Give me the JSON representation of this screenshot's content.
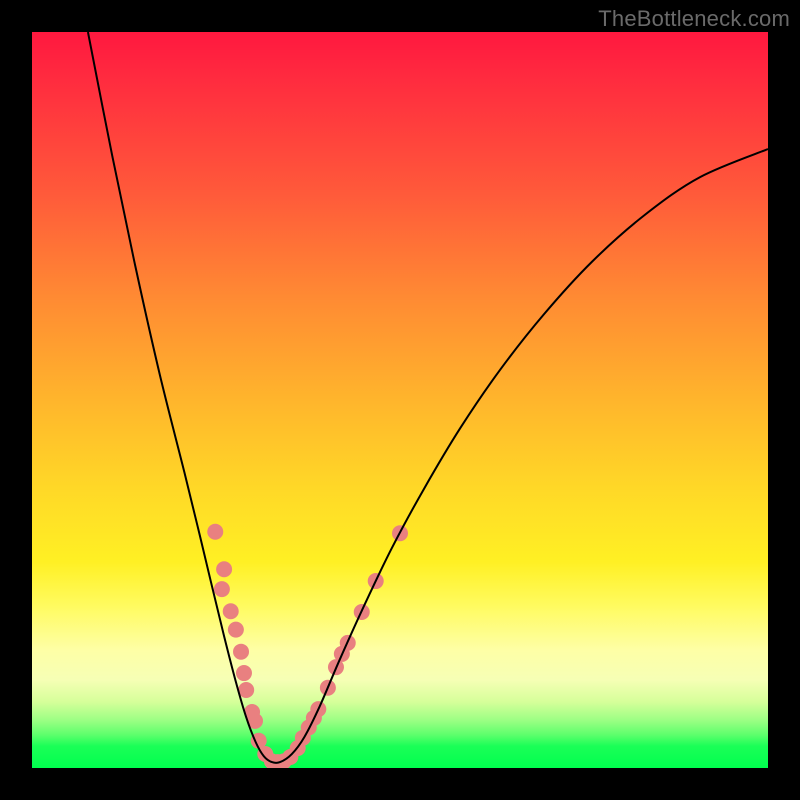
{
  "watermark": "TheBottleneck.com",
  "chart_data": {
    "type": "line",
    "title": "",
    "xlabel": "",
    "ylabel": "",
    "xlim": [
      0,
      100
    ],
    "ylim": [
      0,
      100
    ],
    "grid": false,
    "legend": false,
    "curve_points": [
      {
        "x": 7.6,
        "y": 100.0
      },
      {
        "x": 10.9,
        "y": 83.2
      },
      {
        "x": 14.1,
        "y": 67.9
      },
      {
        "x": 17.4,
        "y": 53.3
      },
      {
        "x": 20.7,
        "y": 40.2
      },
      {
        "x": 22.8,
        "y": 31.6
      },
      {
        "x": 24.5,
        "y": 24.5
      },
      {
        "x": 26.1,
        "y": 17.9
      },
      {
        "x": 27.7,
        "y": 11.7
      },
      {
        "x": 29.1,
        "y": 6.9
      },
      {
        "x": 30.4,
        "y": 3.5
      },
      {
        "x": 31.5,
        "y": 1.6
      },
      {
        "x": 32.6,
        "y": 0.8
      },
      {
        "x": 33.7,
        "y": 0.8
      },
      {
        "x": 35.3,
        "y": 1.9
      },
      {
        "x": 37.0,
        "y": 4.2
      },
      {
        "x": 39.1,
        "y": 8.4
      },
      {
        "x": 41.8,
        "y": 14.7
      },
      {
        "x": 45.1,
        "y": 22.0
      },
      {
        "x": 48.9,
        "y": 29.9
      },
      {
        "x": 53.3,
        "y": 38.0
      },
      {
        "x": 58.2,
        "y": 46.2
      },
      {
        "x": 63.6,
        "y": 54.1
      },
      {
        "x": 69.6,
        "y": 61.7
      },
      {
        "x": 76.1,
        "y": 68.8
      },
      {
        "x": 83.2,
        "y": 75.1
      },
      {
        "x": 90.8,
        "y": 80.3
      },
      {
        "x": 100.0,
        "y": 84.1
      }
    ],
    "markers": [
      {
        "x": 24.9,
        "y": 32.1
      },
      {
        "x": 26.1,
        "y": 27.0
      },
      {
        "x": 25.8,
        "y": 24.3
      },
      {
        "x": 27.0,
        "y": 21.3
      },
      {
        "x": 27.7,
        "y": 18.8
      },
      {
        "x": 28.4,
        "y": 15.8
      },
      {
        "x": 28.8,
        "y": 12.9
      },
      {
        "x": 29.1,
        "y": 10.6
      },
      {
        "x": 29.9,
        "y": 7.6
      },
      {
        "x": 30.3,
        "y": 6.4
      },
      {
        "x": 30.8,
        "y": 3.7
      },
      {
        "x": 31.7,
        "y": 1.9
      },
      {
        "x": 32.6,
        "y": 0.9
      },
      {
        "x": 33.4,
        "y": 0.8
      },
      {
        "x": 34.2,
        "y": 0.9
      },
      {
        "x": 35.1,
        "y": 1.5
      },
      {
        "x": 36.1,
        "y": 2.7
      },
      {
        "x": 36.8,
        "y": 4.1
      },
      {
        "x": 37.6,
        "y": 5.5
      },
      {
        "x": 38.3,
        "y": 6.8
      },
      {
        "x": 38.9,
        "y": 8.0
      },
      {
        "x": 40.2,
        "y": 10.9
      },
      {
        "x": 41.3,
        "y": 13.7
      },
      {
        "x": 42.1,
        "y": 15.5
      },
      {
        "x": 42.9,
        "y": 17.0
      },
      {
        "x": 44.8,
        "y": 21.2
      },
      {
        "x": 46.7,
        "y": 25.4
      },
      {
        "x": 50.0,
        "y": 31.9
      }
    ],
    "marker_color": "#e98080",
    "marker_radius_px": 8,
    "curve_stroke": "#000000",
    "curve_stroke_width_px": 2
  }
}
